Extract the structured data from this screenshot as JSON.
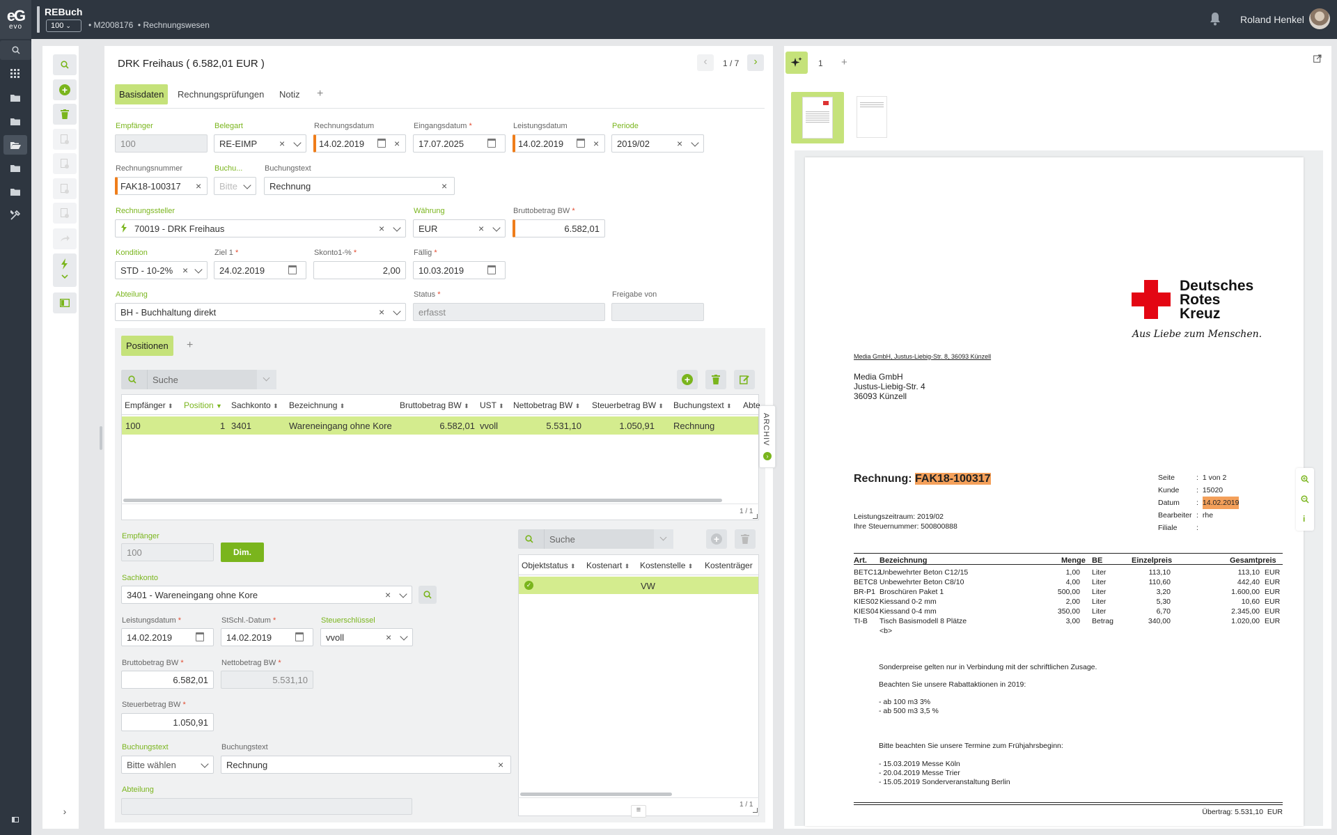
{
  "app": {
    "title": "REBuch",
    "mandant": "100",
    "breadcrumb": [
      "M2008176",
      "Rechnungswesen"
    ],
    "user": "Roland Henkel",
    "logo_text": "evo"
  },
  "header": {
    "title": "DRK Freihaus ( 6.582,01 EUR )",
    "pager": "1 / 7"
  },
  "tabs": [
    {
      "label": "Basisdaten"
    },
    {
      "label": "Rechnungsprüfungen"
    },
    {
      "label": "Notiz"
    }
  ],
  "form": {
    "empfaenger": {
      "label": "Empfänger",
      "value": "100"
    },
    "belegart": {
      "label": "Belegart",
      "value": "RE-EIMP"
    },
    "rechnungsdatum": {
      "label": "Rechnungsdatum",
      "value": "14.02.2019"
    },
    "eingangsdatum": {
      "label": "Eingangsdatum",
      "value": "17.07.2025"
    },
    "leistungsdatum": {
      "label": "Leistungsdatum",
      "value": "14.02.2019"
    },
    "periode": {
      "label": "Periode",
      "value": "2019/02"
    },
    "rechnungsnummer": {
      "label": "Rechnungsnummer",
      "value": "FAK18-100317"
    },
    "buchungskreis": {
      "label": "Buchu...",
      "placeholder": "Bitte"
    },
    "buchungstext": {
      "label": "Buchungstext",
      "value": "Rechnung"
    },
    "rechnungssteller": {
      "label": "Rechnungssteller",
      "value": "70019 - DRK Freihaus"
    },
    "waehrung": {
      "label": "Währung",
      "value": "EUR"
    },
    "bruttobetrag": {
      "label": "Bruttobetrag BW",
      "value": "6.582,01"
    },
    "kondition": {
      "label": "Kondition",
      "value": "STD - 10-2%"
    },
    "ziel1": {
      "label": "Ziel 1",
      "value": "24.02.2019"
    },
    "skonto": {
      "label": "Skonto1-%",
      "value": "2,00"
    },
    "faellig": {
      "label": "Fällig",
      "value": "10.03.2019"
    },
    "abteilung": {
      "label": "Abteilung",
      "value": "BH - Buchhaltung direkt"
    },
    "status": {
      "label": "Status",
      "value": "erfasst"
    },
    "freigabe": {
      "label": "Freigabe von",
      "value": ""
    }
  },
  "positionen": {
    "tab": "Positionen",
    "search_placeholder": "Suche",
    "columns": [
      "Empfänger",
      "Position",
      "Sachkonto",
      "Bezeichnung",
      "Bruttobetrag BW",
      "UST",
      "Nettobetrag BW",
      "Steuerbetrag BW",
      "Buchungstext",
      "Abte"
    ],
    "rows": [
      [
        "100",
        "1",
        "3401",
        "Wareneingang ohne Kore",
        "6.582,01",
        "vvoll",
        "5.531,10",
        "1.050,91",
        "Rechnung",
        ""
      ]
    ],
    "pager": "1 / 1",
    "side_tab": "ARCHIV"
  },
  "detail": {
    "empfaenger": {
      "label": "Empfänger",
      "value": "100"
    },
    "dim_button": "Dim.",
    "sachkonto": {
      "label": "Sachkonto",
      "value": "3401 - Wareneingang ohne Kore"
    },
    "leistungsdatum": {
      "label": "Leistungsdatum",
      "value": "14.02.2019"
    },
    "stschl_datum": {
      "label": "StSchl.-Datum",
      "value": "14.02.2019"
    },
    "steuerschluessel": {
      "label": "Steuerschlüssel",
      "value": "vvoll"
    },
    "brutto": {
      "label": "Bruttobetrag BW",
      "value": "6.582,01"
    },
    "netto": {
      "label": "Nettobetrag BW",
      "value": "5.531,10"
    },
    "steuer": {
      "label": "Steuerbetrag BW",
      "value": "1.050,91"
    },
    "buchungstext_sel": {
      "label": "Buchungstext",
      "value": "Bitte wählen"
    },
    "buchungstext": {
      "label": "Buchungstext",
      "value": "Rechnung"
    },
    "abteilung": {
      "label": "Abteilung",
      "value": ""
    }
  },
  "kore": {
    "search_placeholder": "Suche",
    "columns": [
      "Objektstatus",
      "Kostenart",
      "Kostenstelle",
      "Kostenträger"
    ],
    "rows": [
      [
        "",
        "",
        "VW",
        ""
      ]
    ],
    "pager": "1 / 1"
  },
  "viewer": {
    "page_tab": "1"
  },
  "invoice": {
    "logo_line1": "Deutsches",
    "logo_line2": "Rotes",
    "logo_line3": "Kreuz",
    "slogan": "Aus Liebe zum Menschen.",
    "sender_line": "Media GmbH, Justus-Liebig-Str. 8, 36093 Künzell",
    "addr1": "Media GmbH",
    "addr2": "Justus-Liebig-Str. 4",
    "addr3": "36093 Künzell",
    "title_prefix": "Rechnung:",
    "number": "FAK18-100317",
    "meta": [
      {
        "k": "Seite",
        "v": "1 von 2"
      },
      {
        "k": "Kunde",
        "v": "15020"
      },
      {
        "k": "Datum",
        "v": "14.02.2019"
      },
      {
        "k": "Bearbeiter",
        "v": "rhe"
      },
      {
        "k": "Filiale",
        "v": ""
      }
    ],
    "leistungszeitraum": "Leistungszeitraum: 2019/02",
    "steuernummer": "Ihre Steuernummer: 500800888",
    "columns": [
      "Art.",
      "Bezeichnung",
      "Menge",
      "BE",
      "Einzelpreis",
      "Gesamtpreis"
    ],
    "items": [
      [
        "BETC12",
        "Unbewehrter Beton C12/15",
        "1,00",
        "Liter",
        "113,10",
        "113,10",
        "EUR"
      ],
      [
        "BETC8",
        "Unbewehrter Beton C8/10",
        "4,00",
        "Liter",
        "110,60",
        "442,40",
        "EUR"
      ],
      [
        "BR-P1",
        "Broschüren Paket 1",
        "500,00",
        "Liter",
        "3,20",
        "1.600,00",
        "EUR"
      ],
      [
        "KIES02",
        "Kiessand 0-2 mm",
        "2,00",
        "Liter",
        "5,30",
        "10,60",
        "EUR"
      ],
      [
        "KIES04",
        "Kiessand 0-4 mm",
        "350,00",
        "Liter",
        "6,70",
        "2.345,00",
        "EUR"
      ],
      [
        "TI-B",
        "Tisch Basismodell 8 Plätze",
        "3,00",
        "Betrag",
        "340,00",
        "1.020,00",
        "EUR"
      ]
    ],
    "item_extra": "<b>",
    "notes": [
      "Sonderpreise gelten nur in Verbindung mit der schriftlichen Zusage.",
      "Beachten Sie unsere Rabattaktionen in 2019:",
      "- ab 100 m3 3%",
      "- ab 500 m3 3,5 %",
      "Bitte beachten Sie unsere Termine zum Frühjahrsbeginn:",
      "- 15.03.2019 Messe Köln",
      "- 20.04.2019 Messe Trier",
      "- 15.05.2019 Sonderveranstaltung Berlin"
    ],
    "uebertrag_label": "Übertrag:",
    "uebertrag_value": "5.531,10",
    "uebertrag_cur": "EUR"
  },
  "colors": {
    "accent": "#8cc63f",
    "highlight_row": "#d4ec8e",
    "required_marker": "#ef7d1a",
    "topbar": "#2e3640"
  }
}
